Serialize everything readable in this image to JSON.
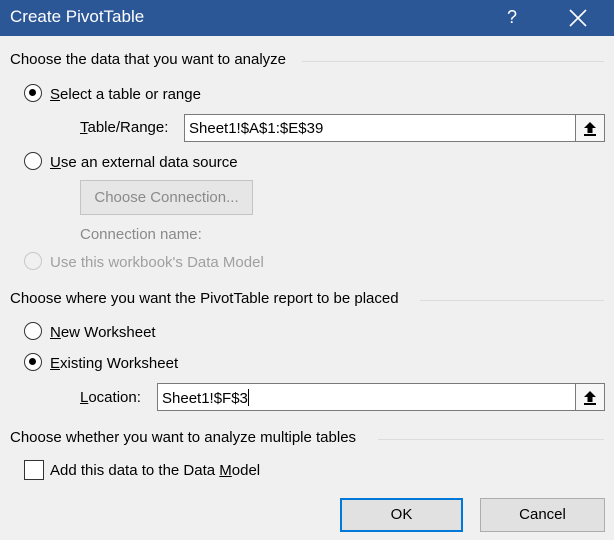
{
  "title": "Create PivotTable",
  "titlebar": {
    "help": "?"
  },
  "section_data": {
    "heading": "Choose the data that you want to analyze"
  },
  "opt_table": {
    "text": "elect a table or range",
    "mnemonic": "S"
  },
  "table_range": {
    "label_rest": "able/Range:",
    "label_mnemonic": "T",
    "value": "Sheet1!$A$1:$E$39"
  },
  "opt_external": {
    "text": "se an external data source",
    "mnemonic": "U"
  },
  "choose_connection": {
    "label": "Choose Connection..."
  },
  "connection_name": {
    "label": "Connection name:"
  },
  "opt_data_model": {
    "text": "Use this workbook's Data Model"
  },
  "section_place": {
    "heading": "Choose where you want the PivotTable report to be placed"
  },
  "opt_new": {
    "mnemonic": "N",
    "text": "ew Worksheet"
  },
  "opt_existing": {
    "mnemonic": "E",
    "text": "xisting Worksheet"
  },
  "location": {
    "mnemonic": "L",
    "label_rest": "ocation:",
    "value": "Sheet1!$F$3"
  },
  "section_multi": {
    "heading": "Choose whether you want to analyze multiple tables"
  },
  "add_model": {
    "text_before": "Add this data to the Data ",
    "mnemonic": "M",
    "text_after": "odel"
  },
  "buttons": {
    "ok": "OK",
    "cancel": "Cancel"
  },
  "colors": {
    "titlebar": "#2b5797",
    "default_button_border": "#0078d7",
    "dialog_bg": "#f0f0f0"
  }
}
